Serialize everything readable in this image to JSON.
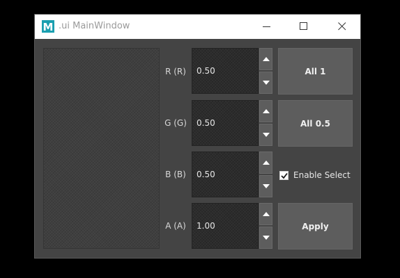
{
  "window": {
    "title": ".ui MainWindow",
    "app_icon_letter": "M"
  },
  "rows": [
    {
      "label": "R (R)",
      "value": "0.50"
    },
    {
      "label": "G (G)",
      "value": "0.50"
    },
    {
      "label": "B (B)",
      "value": "0.50"
    },
    {
      "label": "A (A)",
      "value": "1.00"
    }
  ],
  "buttons": {
    "all_one": "All 1",
    "all_half": "All 0.5",
    "apply": "Apply"
  },
  "enable_select": {
    "label": "Enable Select",
    "checked": true
  },
  "colors": {
    "window_bg": "#444444",
    "field_bg": "#2c2c2c",
    "button_bg": "#5d5d5d",
    "icon_accent": "#1a9fb0"
  }
}
